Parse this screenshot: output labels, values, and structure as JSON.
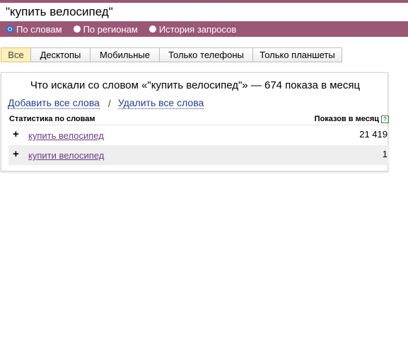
{
  "search": {
    "query": "\"купить велосипед\""
  },
  "modes": [
    {
      "label": "По словам",
      "checked": true
    },
    {
      "label": "По регионам",
      "checked": false
    },
    {
      "label": "История запросов",
      "checked": false
    }
  ],
  "tabs": [
    {
      "label": "Все",
      "active": true
    },
    {
      "label": "Десктопы",
      "active": false
    },
    {
      "label": "Мобильные",
      "active": false
    },
    {
      "label": "Только телефоны",
      "active": false
    },
    {
      "label": "Только планшеты",
      "active": false
    }
  ],
  "results": {
    "title": "Что искали со словом «\"купить велосипед\"» — 674 показа в месяц",
    "add_all_label": "Добавить все слова",
    "separator": "/",
    "remove_all_label": "Удалить все слова",
    "stats_header": "Статистика по словам",
    "impressions_header": "Показов в месяц",
    "help_symbol": "?",
    "rows": [
      {
        "plus": "+",
        "phrase": "купить велосипед",
        "count": "21 419"
      },
      {
        "plus": "+",
        "phrase": "купити велосипед",
        "count": "1"
      }
    ]
  },
  "colors": {
    "header_bg": "#9a5875",
    "active_tab": "#fff0b8",
    "link": "#1f3f91",
    "visited_link": "#6b3a86"
  }
}
